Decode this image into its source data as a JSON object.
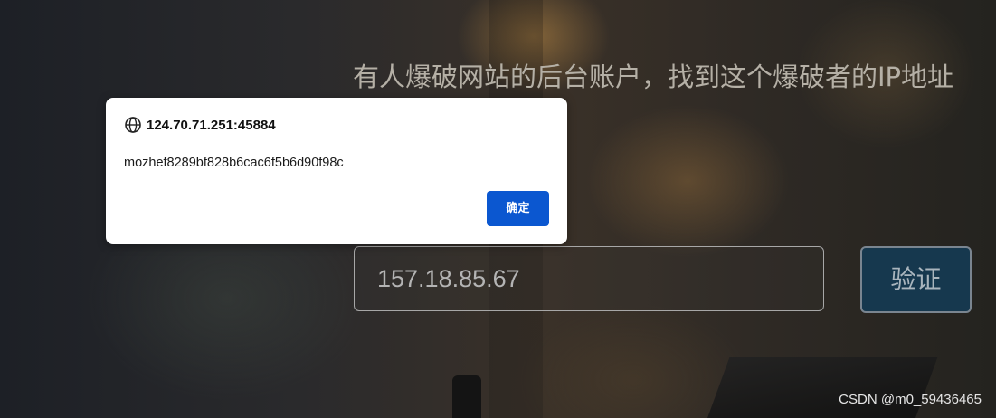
{
  "page": {
    "headline": "有人爆破网站的后台账户，找到这个爆破者的IP地址",
    "ip_input_value": "157.18.85.67",
    "verify_label": "验证",
    "watermark": "CSDN @m0_59436465"
  },
  "dialog": {
    "origin": "124.70.71.251:45884",
    "origin_icon": "globe-icon",
    "message": "mozhef8289bf828b6cac6f5b6d90f98c",
    "ok_label": "确定",
    "ok_color": "#0b57d0"
  }
}
